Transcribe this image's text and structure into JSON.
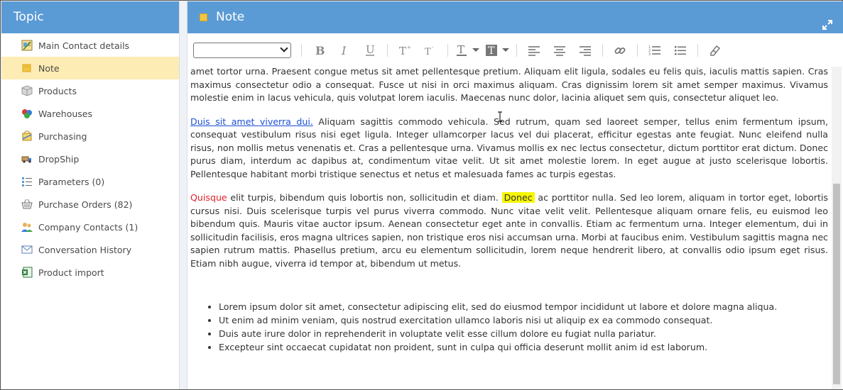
{
  "sidebar": {
    "title": "Topic",
    "items": [
      {
        "label": "Main Contact details",
        "icon": "contact-card-icon"
      },
      {
        "label": "Note",
        "icon": "note-icon"
      },
      {
        "label": "Products",
        "icon": "box-icon"
      },
      {
        "label": "Warehouses",
        "icon": "warehouse-icon"
      },
      {
        "label": "Purchasing",
        "icon": "purchasing-icon"
      },
      {
        "label": "DropShip",
        "icon": "truck-icon"
      },
      {
        "label": "Parameters (0)",
        "icon": "parameters-icon"
      },
      {
        "label": "Purchase Orders (82)",
        "icon": "basket-icon"
      },
      {
        "label": "Company Contacts (1)",
        "icon": "people-icon"
      },
      {
        "label": "Conversation History",
        "icon": "envelope-icon"
      },
      {
        "label": "Product import",
        "icon": "excel-icon"
      }
    ],
    "active_index": 1
  },
  "panel": {
    "title": "Note"
  },
  "editor": {
    "p1": "amet tortor urna. Praesent congue metus sit amet pellentesque pretium. Aliquam elit ligula, sodales eu felis quis, iaculis mattis sapien. Cras maximus consectetur odio a consequat. Fusce ut nisi in orci maximus aliquam. Cras dignissim lorem sit amet semper maximus. Vivamus molestie enim in lacus vehicula, quis volutpat lorem iaculis. Maecenas nunc dolor, lacinia aliquet sem quis, consectetur aliquet leo.",
    "p2_link": "Duis sit amet viverra dui.",
    "p2_rest": " Aliquam sagittis commodo vehicula. Sed rutrum, quam sed laoreet semper, tellus enim fermentum ipsum, consequat vestibulum risus nisi eget ligula. Integer ullamcorper lacus vel dui placerat, efficitur egestas ante feugiat. Nunc eleifend nulla risus, non mollis metus venenatis et. Cras a pellentesque urna. Vivamus mollis ex nec lectus consectetur, dictum porttitor erat dictum. Donec purus diam, interdum ac dapibus at, condimentum vitae velit. Ut sit amet molestie lorem. In eget augue at justo scelerisque lobortis. Pellentesque habitant morbi tristique senectus et netus et malesuada fames ac turpis egestas.",
    "p3_red": "Quisque",
    "p3_mid": " elit turpis, bibendum quis lobortis non, sollicitudin et diam. ",
    "p3_hl": "Donec",
    "p3_rest": " ac porttitor nulla. Sed leo lorem, aliquam in tortor eget, lobortis cursus nisi. Duis scelerisque turpis vel purus viverra commodo. Nunc vitae velit velit. Pellentesque aliquam ornare felis, eu euismod leo bibendum quis. Mauris vitae auctor ipsum. Aenean consectetur eget ante in convallis. Etiam ac fermentum urna. Integer elementum, dui in sollicitudin facilisis, eros magna ultrices sapien, non tristique eros nisi accumsan urna. Morbi at faucibus enim. Vestibulum sagittis magna nec sapien rutrum mattis. Phasellus pretium, arcu eu elementum sollicitudin, lorem neque hendrerit libero, at convallis odio ipsum eget risus. Etiam nibh augue, viverra id tempor at, bibendum ut metus.",
    "bullets": [
      "Lorem ipsum dolor sit amet, consectetur adipiscing elit, sed do eiusmod tempor incididunt ut labore et dolore magna aliqua.",
      "Ut enim ad minim veniam, quis nostrud exercitation ullamco laboris nisi ut aliquip ex ea commodo consequat.",
      "Duis aute irure dolor in reprehenderit in voluptate velit esse cillum dolore eu fugiat nulla pariatur.",
      "Excepteur sint occaecat cupidatat non proident, sunt in culpa qui officia deserunt mollit anim id est laborum."
    ]
  },
  "colors": {
    "header_blue": "#5b9bd5",
    "active_item": "#fdecb3",
    "link": "#1a4fd6",
    "highlight": "#f7f700",
    "red_text": "#e0202a"
  }
}
